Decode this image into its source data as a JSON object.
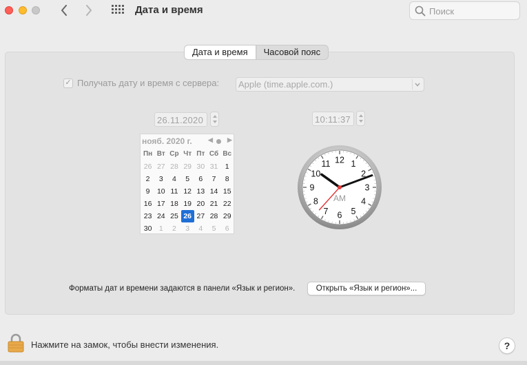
{
  "window": {
    "title": "Дата и время",
    "search_placeholder": "Поиск"
  },
  "tabs": [
    {
      "label": "Дата и время",
      "active": true
    },
    {
      "label": "Часовой пояс",
      "active": false
    }
  ],
  "server": {
    "checked": true,
    "label": "Получать дату и время с сервера:",
    "selected": "Apple (time.apple.com.)"
  },
  "date_value": "26.11.2020",
  "time_value": "10:11:37",
  "calendar": {
    "month_label": "нояб. 2020 г.",
    "weekdays": [
      "Пн",
      "Вт",
      "Ср",
      "Чт",
      "Пт",
      "Сб",
      "Вс"
    ],
    "weeks": [
      [
        "26",
        "27",
        "28",
        "29",
        "30",
        "31",
        "1"
      ],
      [
        "2",
        "3",
        "4",
        "5",
        "6",
        "7",
        "8"
      ],
      [
        "9",
        "10",
        "11",
        "12",
        "13",
        "14",
        "15"
      ],
      [
        "16",
        "17",
        "18",
        "19",
        "20",
        "21",
        "22"
      ],
      [
        "23",
        "24",
        "25",
        "26",
        "27",
        "28",
        "29"
      ],
      [
        "30",
        "1",
        "2",
        "3",
        "4",
        "5",
        "6"
      ]
    ],
    "selected_day": "26"
  },
  "clock": {
    "numerals": [
      "12",
      "1",
      "2",
      "3",
      "4",
      "5",
      "6",
      "7",
      "8",
      "9",
      "10",
      "11"
    ],
    "period": "AM",
    "hours": 10,
    "minutes": 11,
    "seconds": 37
  },
  "formats_text": "Форматы дат и времени задаются в панели «Язык и регион».",
  "open_region_button": "Открыть «Язык и регион»...",
  "lock_text": "Нажмите на замок, чтобы внести изменения.",
  "help_label": "?",
  "colors": {
    "accent": "#1f6fd6",
    "second_hand": "#e23b3b"
  }
}
